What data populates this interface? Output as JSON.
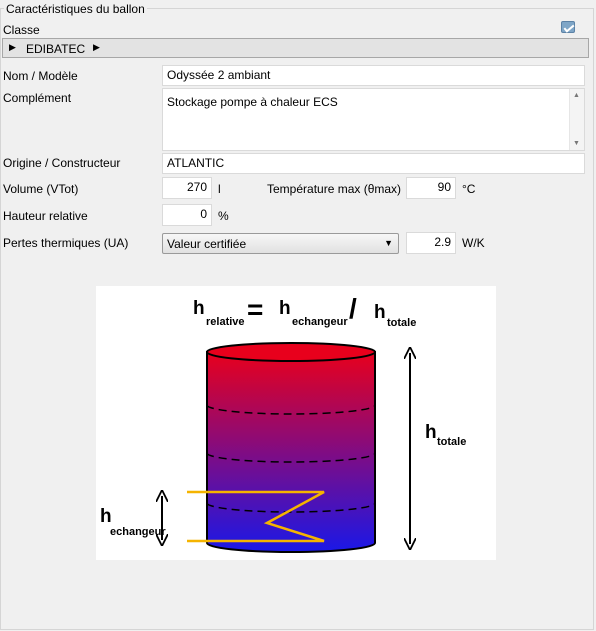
{
  "section_title": "Caractéristiques du ballon",
  "classe": {
    "label": "Classe",
    "value": "EDIBATEC"
  },
  "nom_modele": {
    "label": "Nom / Modèle",
    "value": "Odyssée 2 ambiant"
  },
  "complement": {
    "label": "Complément",
    "value": "Stockage pompe à chaleur ECS"
  },
  "origine": {
    "label": "Origine / Constructeur",
    "value": "ATLANTIC"
  },
  "volume": {
    "label": "Volume (VTot)",
    "value": "270",
    "unit": "l"
  },
  "temperature": {
    "label": "Température max (θmax)",
    "value": "90",
    "unit": "°C"
  },
  "hauteur": {
    "label": "Hauteur relative",
    "value": "0",
    "unit": "%"
  },
  "pertes": {
    "label": "Pertes thermiques (UA)",
    "select_value": "Valeur certifiée",
    "value": "2.9",
    "unit": "W/K"
  },
  "diagram": {
    "h": "h",
    "relative": "relative",
    "echangeur": "echangeur",
    "totale": "totale",
    "equals": "=",
    "slash": "/",
    "colors": {
      "tank_top": "#e8001c",
      "tank_bottom": "#1a18e8",
      "coil": "#f5b400"
    }
  }
}
